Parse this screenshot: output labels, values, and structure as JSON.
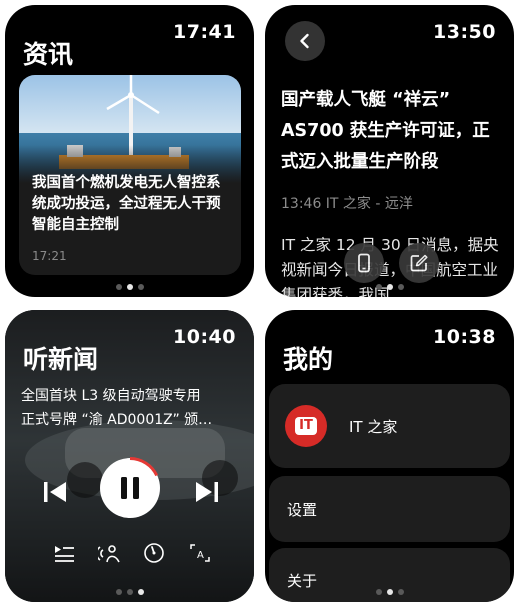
{
  "screens": {
    "news": {
      "time": "17:41",
      "title": "资讯",
      "card": {
        "headline": "我国首个燃机发电无人智控系统成功投运，全过程无人干预智能自主控制",
        "time": "17:21"
      },
      "page_dots": [
        false,
        true,
        false
      ]
    },
    "article": {
      "time": "13:50",
      "back_icon": "chevron-left-icon",
      "title": "国产载人飞艇 “祥云” AS700 获生产许可证，正式迈入批量生产阶段",
      "meta": "13:46  IT 之家 - 远洋",
      "body": "IT 之家 12 月 30 日消息，据央视新闻今日报道，中国航空工业集团获悉，我国",
      "actions": [
        "phone-icon",
        "edit-icon"
      ],
      "page_dots": [
        false,
        true,
        false
      ]
    },
    "player": {
      "time": "10:40",
      "title": "听新闻",
      "headline_line1": "全国首块 L3 级自动驾驶专用",
      "headline_line2": "正式号牌 “渝 AD0001Z” 颁…",
      "progress": 0.18,
      "controls": [
        "previous-icon",
        "pause-icon",
        "next-icon"
      ],
      "tools": [
        "playlist-icon",
        "voice-icon",
        "speed-icon",
        "font-size-icon"
      ],
      "colors": {
        "progress": "#e53935"
      },
      "page_dots": [
        false,
        false,
        true
      ]
    },
    "mine": {
      "time": "10:38",
      "title": "我的",
      "account_name": "IT 之家",
      "logo_text": "IT",
      "settings": "设置",
      "about": "关于",
      "colors": {
        "logo": "#d62b27"
      },
      "page_dots": [
        false,
        true,
        false
      ]
    }
  }
}
